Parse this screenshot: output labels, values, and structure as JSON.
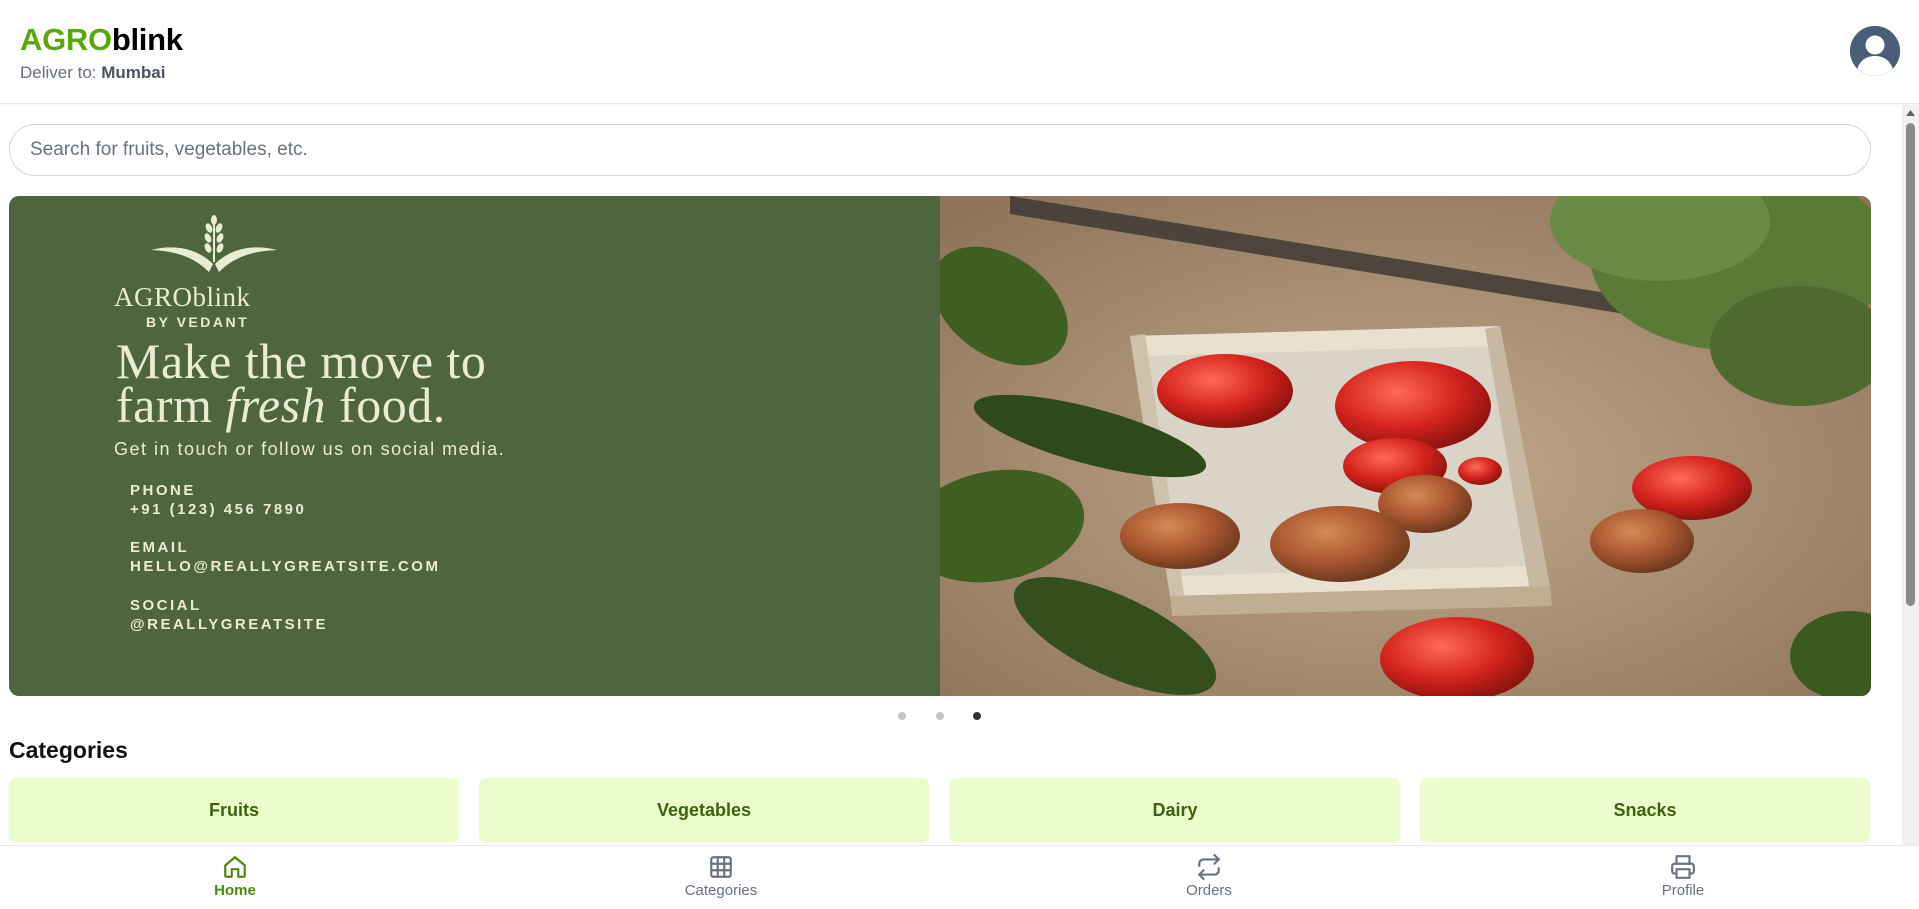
{
  "header": {
    "brand_part1": "AGRO",
    "brand_part2": "blink",
    "deliver_label": "Deliver to: ",
    "deliver_city": "Mumbai"
  },
  "search": {
    "placeholder": "Search for fruits, vegetables, etc."
  },
  "banner": {
    "logo_text": "AGROblink",
    "logo_byline": "BY VEDANT",
    "headline_line1": "Make the move to",
    "headline_line2_before": "farm ",
    "headline_line2_emphasis": "fresh",
    "headline_line2_after": " food.",
    "subtitle": "Get in touch or follow us on social media.",
    "phone_label": "PHONE",
    "phone_value": "+91 (123) 456 7890",
    "email_label": "EMAIL",
    "email_value": "HELLO@REALLYGREATSITE.COM",
    "social_label": "SOCIAL",
    "social_value": "@REALLYGREATSITE"
  },
  "carousel": {
    "slide_count": 3,
    "active_slide": 3
  },
  "categories": {
    "title": "Categories",
    "items": [
      "Fruits",
      "Vegetables",
      "Dairy",
      "Snacks"
    ]
  },
  "bottom_nav": {
    "items": [
      {
        "label": "Home",
        "icon": "home-icon",
        "active": true
      },
      {
        "label": "Categories",
        "icon": "grid-icon",
        "active": false
      },
      {
        "label": "Orders",
        "icon": "repeat-icon",
        "active": false
      },
      {
        "label": "Profile",
        "icon": "printer-icon",
        "active": false
      }
    ]
  },
  "colors": {
    "brand_green": "#5aa80a",
    "banner_green": "#4e6540",
    "category_bg": "#ecfccb",
    "category_text": "#3f6212",
    "nav_active": "#4d8a0e"
  }
}
